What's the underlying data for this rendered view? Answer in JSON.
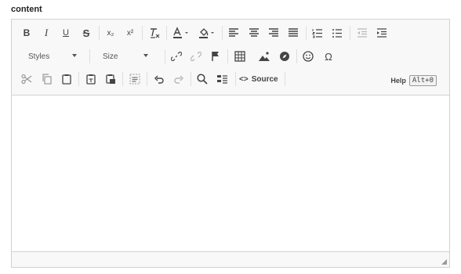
{
  "field_label": "content",
  "toolbar": {
    "styles_label": "Styles",
    "size_label": "Size",
    "source_label": "Source",
    "help_label": "Help",
    "help_shortcut": "Alt+0",
    "subscript_label": "x₂",
    "superscript_label": "x²",
    "special_char_label": "Ω"
  }
}
